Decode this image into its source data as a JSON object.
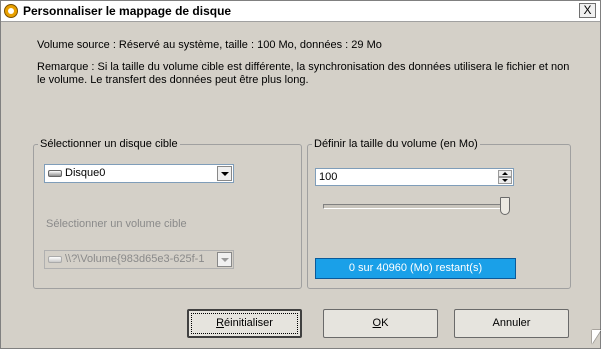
{
  "window": {
    "title": "Personnaliser le mappage de disque",
    "close_glyph": "X",
    "app_icon": "app-logo-icon"
  },
  "info": {
    "source_line": "Volume source : Réservé au système,  taille : 100 Mo,  données : 29 Mo",
    "remark": "Remarque : Si la taille du volume cible est différente, la synchronisation des données utilisera le fichier et non le volume. Le transfert des données peut être plus long."
  },
  "target_disk": {
    "group_label": "Sélectionner un disque cible",
    "disk_value": "Disque0",
    "volume_label": "Sélectionner un volume cible",
    "volume_value": "\\\\?\\Volume{983d65e3-625f-1"
  },
  "volume_size": {
    "group_label": "Définir la taille du volume (en Mo)",
    "size_value": "100",
    "slider_fraction": 1.0,
    "remaining_text": "0 sur 40960 (Mo) restant(s)",
    "status_color": "#1aa0e8"
  },
  "buttons": {
    "reset": "Réinitialiser",
    "ok": "OK",
    "cancel": "Annuler"
  }
}
